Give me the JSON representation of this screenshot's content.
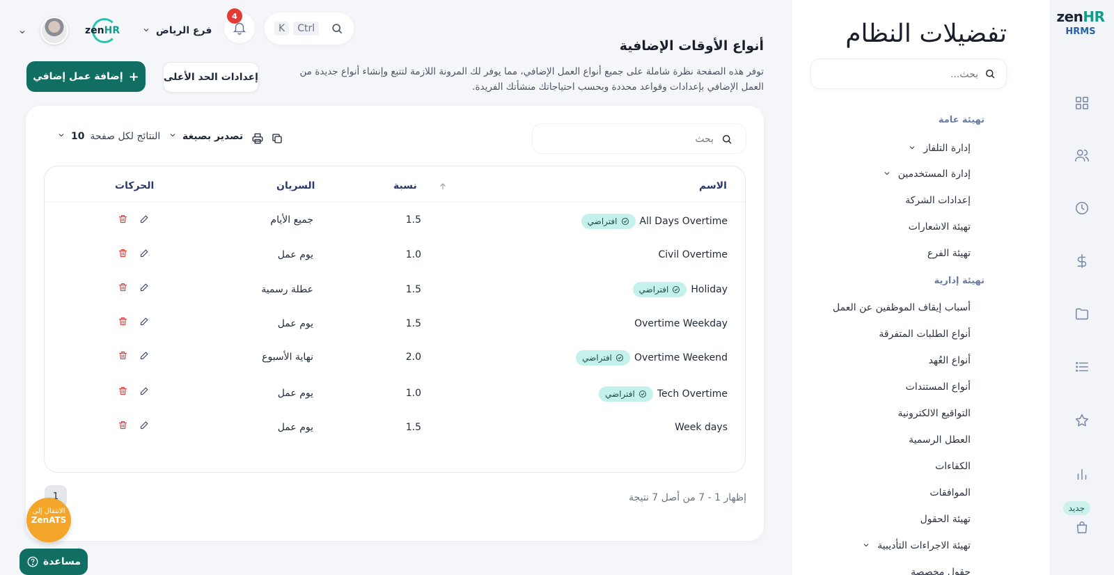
{
  "rail": {
    "brand_zen": "zen",
    "brand_hr": "HR",
    "product": "HRMS",
    "new_badge": "جديد"
  },
  "settings": {
    "title": "تفضيلات النظام",
    "search_placeholder": "بحث...",
    "general_section": "تهيئة عامة",
    "general_items": [
      "إدارة التلفاز",
      "إدارة المستخدمين",
      "إعدادات الشركة",
      "تهيئة الاشعارات",
      "تهيئة الفرع"
    ],
    "admin_section": "تهيئة إدارية",
    "admin_items": [
      "أسباب إيقاف الموظفين عن العمل",
      "أنواع الطلبات المتفرقة",
      "أنواع العُهد",
      "أنواع المستندات",
      "التواقيع الالكترونية",
      "العطل الرسمية",
      "الكفاءات",
      "الموافقات",
      "تهيئة الحقول",
      "تهيئة الاجراءات التأديبية",
      "حقول مخصصة"
    ]
  },
  "topbar": {
    "branch": "فرع الرياض",
    "notifications_count": "4",
    "kbd_ctrl": "Ctrl",
    "kbd_k": "K",
    "mini_logo_zen": "zen",
    "mini_logo_hr": "HR"
  },
  "page": {
    "title": "أنواع الأوقات الإضافية",
    "description": "توفر هذه الصفحة نظرة شاملة على جميع أنواع العمل الإضافي، مما يوفر لك المرونة اللازمة لتتبع وإنشاء أنواع جديدة من العمل الإضافي بإعدادات وقواعد محددة وبحسب احتياجاتك منشأتك الفريدة.",
    "max_settings_label": "إعدادات الحد الأعلى",
    "add_label": "إضافة عمل إضافي"
  },
  "table": {
    "search_placeholder": "بحث",
    "export_label": "تصدير بصيغة",
    "per_page_label": "النتائج لكل صفحة",
    "per_page_value": "10",
    "headers": {
      "name": "الاسم",
      "ratio": "نسبة",
      "applies": "السريان",
      "actions": "الحركات"
    },
    "default_badge": "افتراضي",
    "rows": [
      {
        "name": "All Days Overtime",
        "default": true,
        "ratio": "1.5",
        "applies": "جميع الأيام"
      },
      {
        "name": "Civil Overtime",
        "default": false,
        "ratio": "1.0",
        "applies": "يوم عمل"
      },
      {
        "name": "Holiday",
        "default": true,
        "ratio": "1.5",
        "applies": "عطلة رسمية"
      },
      {
        "name": "Overtime Weekday",
        "default": false,
        "ratio": "1.5",
        "applies": "يوم عمل"
      },
      {
        "name": "Overtime Weekend",
        "default": true,
        "ratio": "2.0",
        "applies": "نهاية الأسبوع"
      },
      {
        "name": "Tech Overtime",
        "default": true,
        "ratio": "1.0",
        "applies": "يوم عمل"
      },
      {
        "name": "Week days",
        "default": false,
        "ratio": "1.5",
        "applies": "يوم عمل"
      }
    ],
    "showing": "إظهار 1 - 7 من أصل 7 نتيجة",
    "current_page": "1"
  },
  "floating": {
    "zenats_line1": "الانتقال إلى",
    "zenats_line2": "ZenATS",
    "help_label": "مساعدة"
  }
}
